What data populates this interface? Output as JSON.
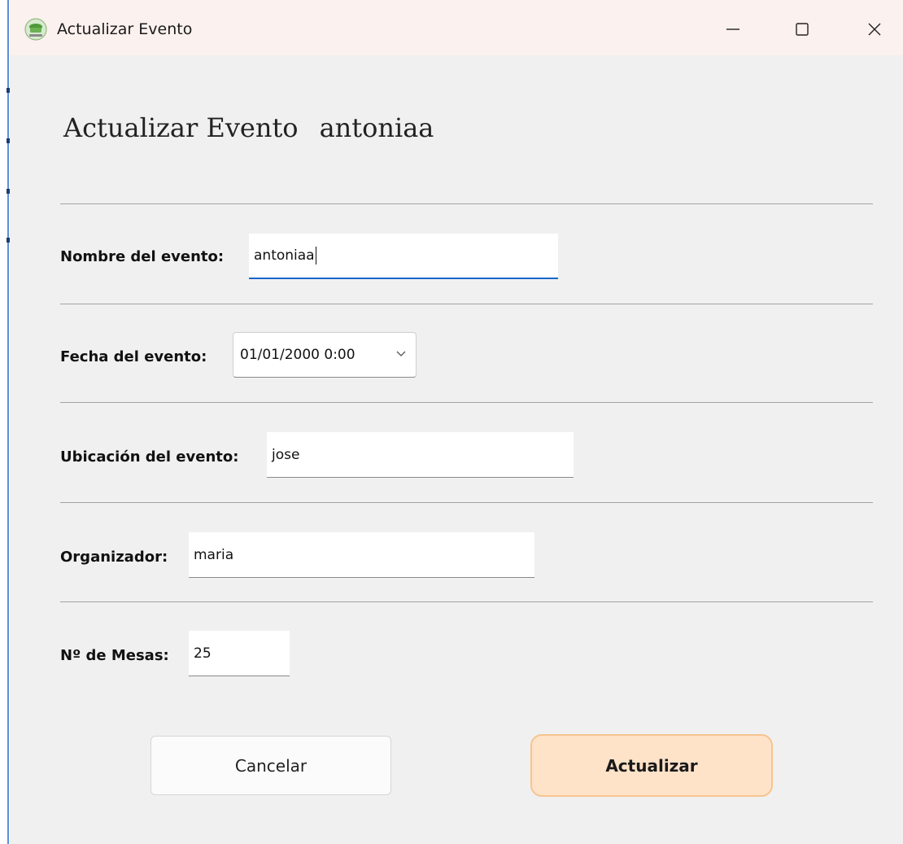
{
  "window": {
    "title": "Actualizar Evento"
  },
  "header": {
    "title": "Actualizar Evento",
    "event_name": "antoniaa"
  },
  "form": {
    "nombre": {
      "label": "Nombre del evento:",
      "value": "antoniaa"
    },
    "fecha": {
      "label": "Fecha del evento:",
      "value": "01/01/2000 0:00"
    },
    "ubicacion": {
      "label": "Ubicación del evento:",
      "value": "jose"
    },
    "organizador": {
      "label": "Organizador:",
      "value": "maria"
    },
    "mesas": {
      "label": "Nº de Mesas:",
      "value": "25"
    }
  },
  "buttons": {
    "cancel": "Cancelar",
    "update": "Actualizar"
  },
  "colors": {
    "focus_accent": "#1b66c9",
    "primary_button_bg": "#ffe3c9",
    "primary_button_border": "#f6c48f",
    "titlebar_bg": "#fbf1ee",
    "window_bg": "#f0f0f0"
  },
  "icons": {
    "app": "app-icon",
    "minimize": "minimize-icon",
    "maximize": "maximize-icon",
    "close": "close-icon",
    "dropdown": "chevron-down-icon"
  }
}
